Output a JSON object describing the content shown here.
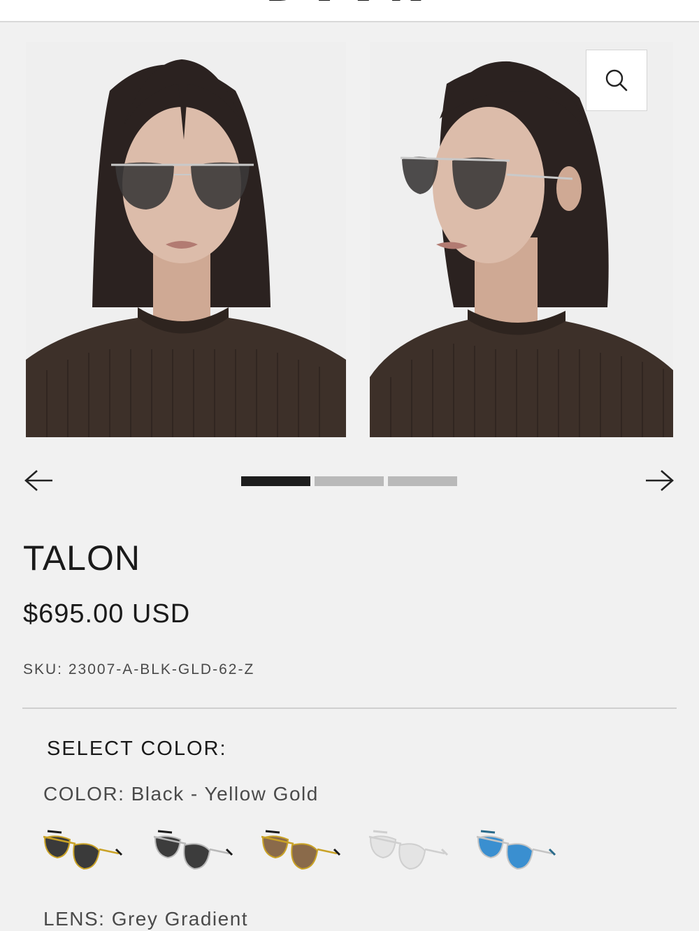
{
  "header": {
    "logo_text": "DITA"
  },
  "gallery": {
    "photos": [
      {
        "alt": "Model wearing Talon sunglasses, front view"
      },
      {
        "alt": "Model wearing Talon sunglasses, three-quarter view"
      }
    ],
    "zoom_icon": "search-icon",
    "prev_icon": "arrow-left-icon",
    "next_icon": "arrow-right-icon",
    "slide_count": 3,
    "active_slide": 1
  },
  "product": {
    "name": "TALON",
    "price": "$695.00 USD",
    "sku": "SKU: 23007-A-BLK-GLD-62-Z"
  },
  "options": {
    "select_color_label": "SELECT COLOR:",
    "color_label": "COLOR: Black - Yellow Gold",
    "lens_label": "LENS: Grey Gradient",
    "swatches": [
      {
        "name": "Black - Yellow Gold",
        "frame": "#c9a227",
        "lens": "#3a3a3a",
        "tip": "#1a1a1a"
      },
      {
        "name": "Black - Silver",
        "frame": "#b8b8b8",
        "lens": "#3c3c3c",
        "tip": "#1a1a1a"
      },
      {
        "name": "Yellow Gold - Brown",
        "frame": "#c9a227",
        "lens": "#8a6a4a",
        "tip": "#1a1a1a"
      },
      {
        "name": "Silver - Clear",
        "frame": "#cfcfcf",
        "lens": "#e4e4e4",
        "tip": "#cfcfcf"
      },
      {
        "name": "Silver - Blue",
        "frame": "#c4c4c4",
        "lens": "#3a8fd0",
        "tip": "#2a6a8a"
      }
    ]
  },
  "colors": {
    "background": "#f1f1f1",
    "active_dot": "#1d1d1d",
    "inactive_dot": "#b9b9b9",
    "sweater": "#3d3029",
    "hair": "#2b2220",
    "skin": "#d9b8a6"
  }
}
